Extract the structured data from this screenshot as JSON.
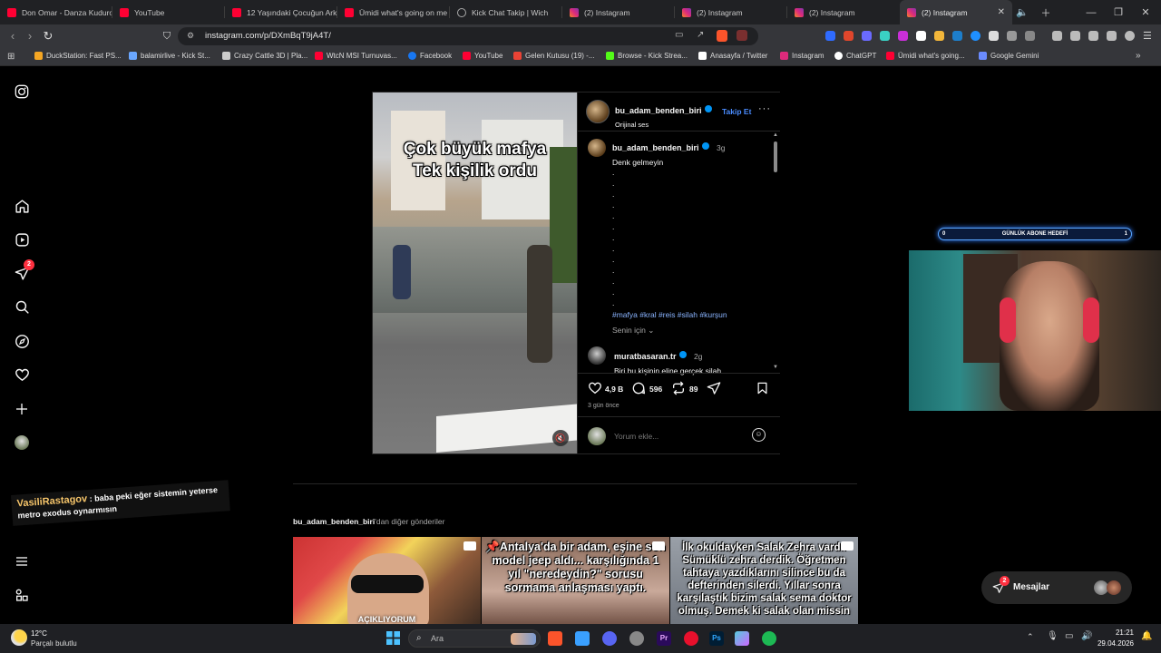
{
  "browser": {
    "tabs": [
      {
        "label": "Don Omar - Danza Kuduro",
        "icon": "youtube-icon"
      },
      {
        "label": "YouTube",
        "icon": "youtube-icon"
      },
      {
        "label": "12 Yaşındaki Çocuğun Arkadaşı",
        "icon": "youtube-icon"
      },
      {
        "label": "Ümidi what's going on me",
        "icon": "youtube-icon"
      },
      {
        "label": "Kick Chat Takip | Wich",
        "icon": "globe-icon"
      },
      {
        "label": "(2) Instagram",
        "icon": "instagram-icon"
      },
      {
        "label": "(2) Instagram",
        "icon": "instagram-icon"
      },
      {
        "label": "(2) Instagram",
        "icon": "instagram-icon"
      },
      {
        "label": "(2) Instagram",
        "icon": "instagram-icon",
        "active": true
      }
    ],
    "url": "instagram.com/p/DXmBqT9jA4T/",
    "bookmarks": [
      "DuckStation: Fast PS...",
      "balamirlive - Kick St...",
      "Crazy Cattle 3D | Pla...",
      "WtcN MSI Turnuvas...",
      "Facebook",
      "YouTube",
      "Gelen Kutusu (19) -...",
      "Browse - Kick Strea...",
      "Anasayfa / Twitter",
      "Instagram",
      "ChatGPT",
      "Ümidi what's going...",
      "Google Gemini"
    ]
  },
  "sidebar": {
    "notification_count": "2"
  },
  "post": {
    "video_caption_line1": "Çok büyük mafya",
    "video_caption_line2": "Tek kişilik ordu",
    "author": "bu_adam_benden_biri",
    "audio": "Orijinal ses",
    "follow_label": "Takip Et",
    "caption_author": "bu_adam_benden_biri",
    "caption_age": "3g",
    "caption_text": "Denk gelmeyin",
    "dots": [
      ".",
      ".",
      ".",
      ".",
      ".",
      ".",
      ".",
      ".",
      ".",
      ".",
      ".",
      ".",
      "."
    ],
    "hashtags": "#mafya #kral #reis #silah #kurşun",
    "for_you": "Senin için",
    "comment": {
      "author": "muratbasaran.tr",
      "age": "2g",
      "text": "Biri bu kişinin eline gerçek silah"
    },
    "likes": "4,9 B",
    "comments": "596",
    "reposts": "89",
    "posted": "3 gün önce",
    "comment_placeholder": "Yorum ekle..."
  },
  "more_posts": {
    "author": "bu_adam_benden_biri",
    "suffix": "'dan diğer gönderiler",
    "items": [
      {
        "text": "AÇIKLIYORUM"
      },
      {
        "text": "📌Antalya'da bir adam, eşine son model jeep aldı... karşılığında 1 yıl \"neredeydin?\" sorusu sormama anlaşması yaptı."
      },
      {
        "text": "İlk okuldayken Salak Zehra vardı. Sümüklü zehra derdik. Öğretmen tahtaya yazdıklarını silince bu da defterinden silerdi. Yıllar sonra karşılaştık bizim salak sema doktor olmuş. Demek ki salak olan missin"
      }
    ]
  },
  "overlay": {
    "goal_title": "GÜNLÜK ABONE HEDEFİ",
    "goal_start": "0",
    "goal_end": "1",
    "chat_user": "VasiliRastagov",
    "chat_text_1": ": baba peki eğer sistemin yeterse",
    "chat_text_2": "metro exodus oynarmısın"
  },
  "messages": {
    "label": "Mesajlar",
    "count": "2"
  },
  "taskbar": {
    "weather_temp": "12°C",
    "weather_desc": "Parçalı bulutlu",
    "search_placeholder": "Ara",
    "time": "21:21",
    "date": "29.04.2026"
  }
}
